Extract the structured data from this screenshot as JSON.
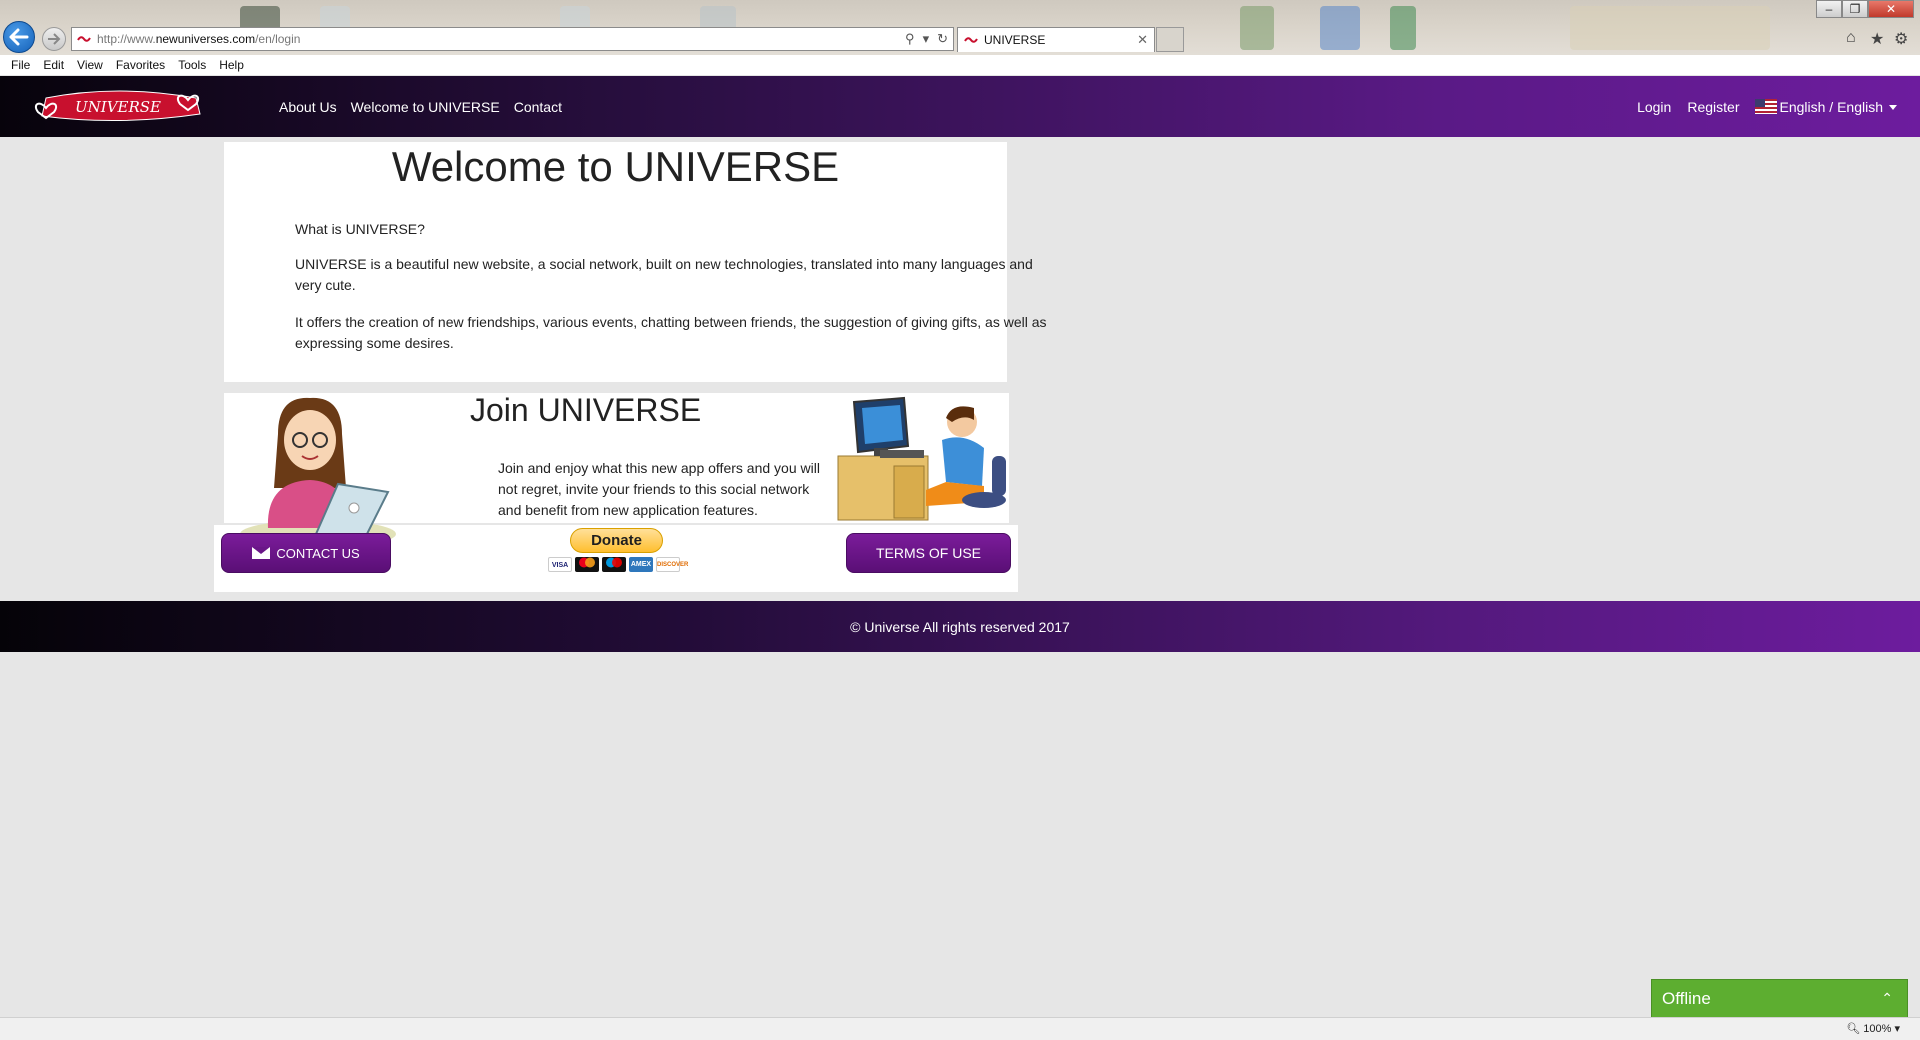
{
  "browser": {
    "url_prefix": "http://www.",
    "url_domain": "newuniverses.com",
    "url_path": "/en/login",
    "tab_title": "UNIVERSE",
    "menu": [
      "File",
      "Edit",
      "View",
      "Favorites",
      "Tools",
      "Help"
    ],
    "zoom": "100%"
  },
  "nav": {
    "logo_text": "UNIVERSE",
    "links": [
      "About Us",
      "Welcome to UNIVERSE",
      "Contact"
    ],
    "login": "Login",
    "register": "Register",
    "language": "English / English"
  },
  "welcome": {
    "title": "Welcome to UNIVERSE",
    "question": "What is UNIVERSE?",
    "para1": "UNIVERSE is a beautiful new website, a social network, built on new technologies, translated into many languages and very cute.",
    "para2": "It offers the creation of new friendships, various events, chatting between friends, the suggestion of giving gifts, as well as expressing some desires."
  },
  "join": {
    "title": "Join UNIVERSE",
    "text": "Join and enjoy what this new app offers and you will not regret, invite your friends to this social network and benefit from new application features.",
    "contact_label": "CONTACT US",
    "donate_label": "Donate",
    "terms_label": "TERMS OF USE",
    "card_brands": [
      "VISA",
      "MC",
      "MAESTRO",
      "AMEX",
      "DISCOVER"
    ]
  },
  "footer": {
    "text": "© Universe All rights reserved 2017"
  },
  "chat": {
    "status": "Offline"
  },
  "colors": {
    "nav_purple": "#6d1c9e",
    "button_purple": "#6a1688",
    "offline_green": "#5dae30"
  }
}
